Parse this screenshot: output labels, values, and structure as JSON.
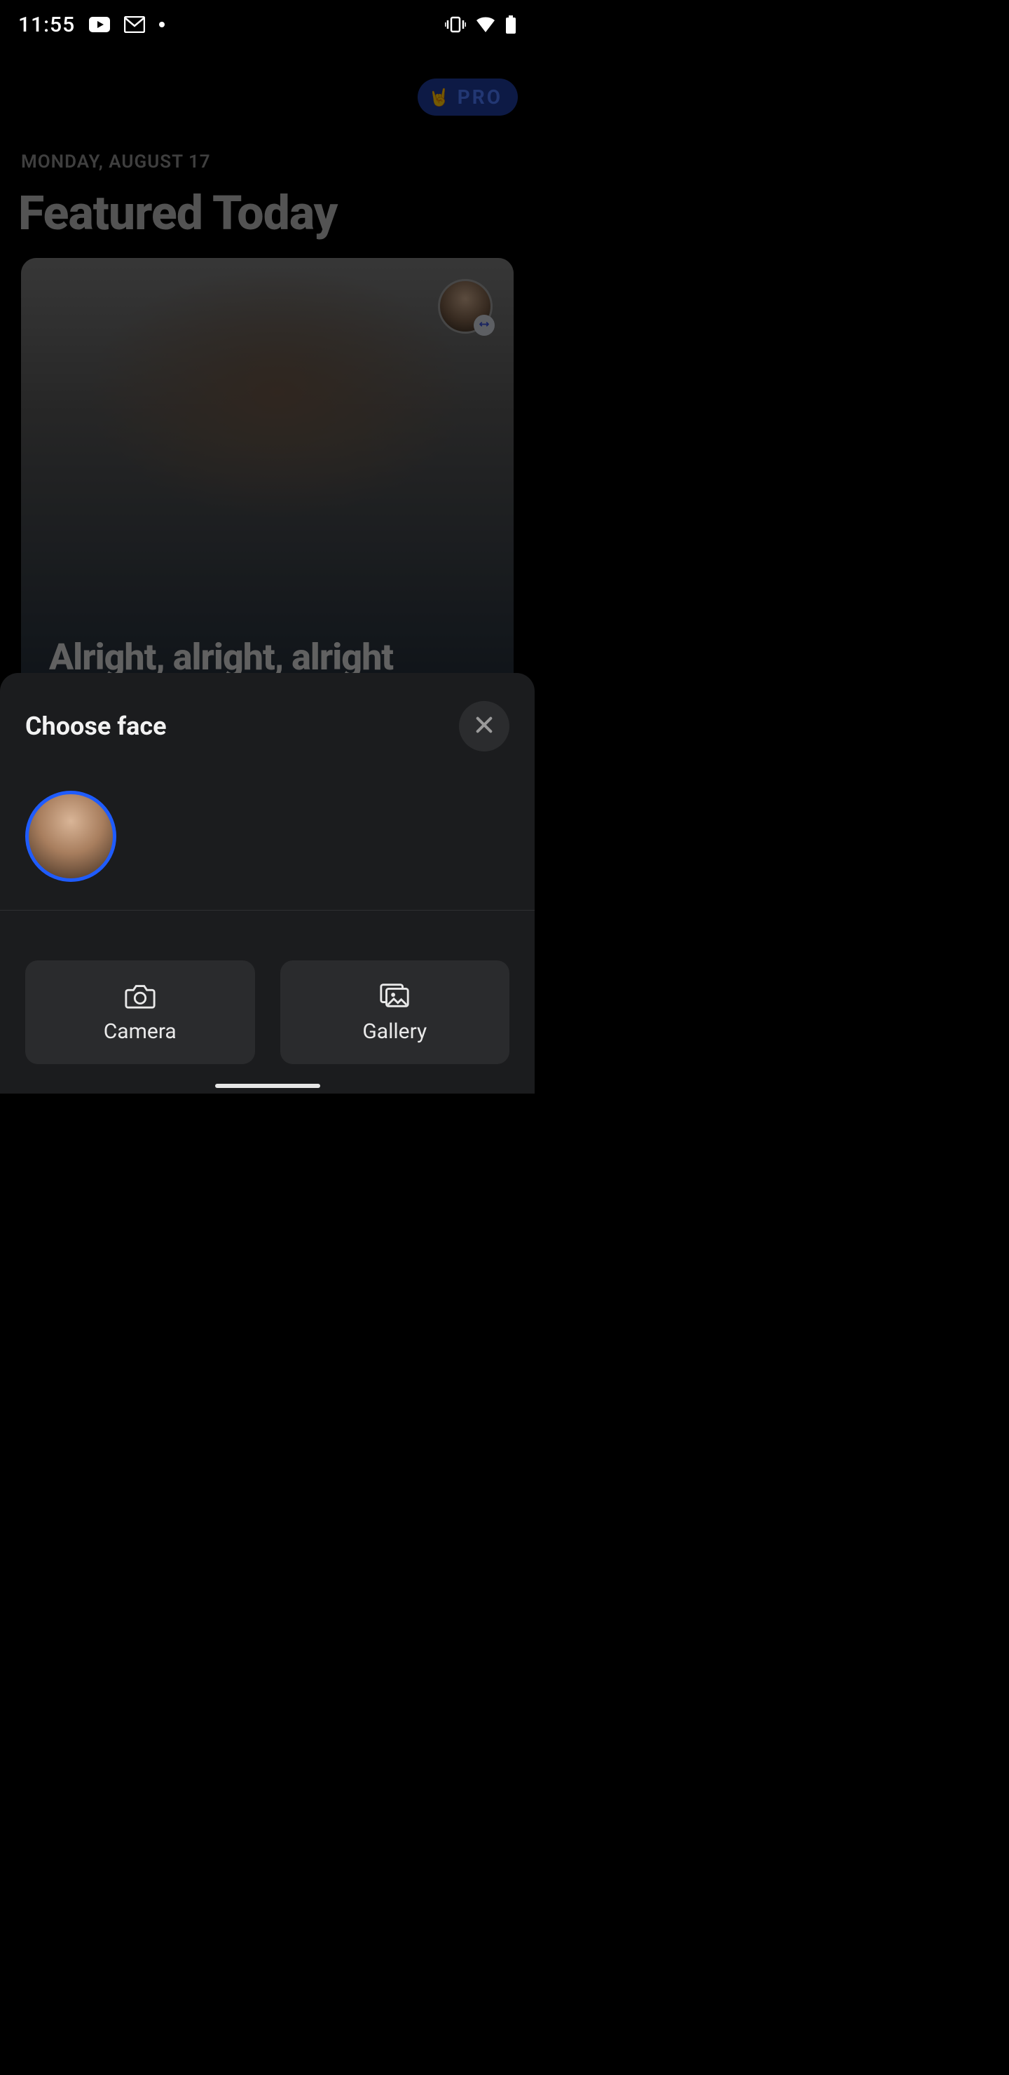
{
  "status": {
    "time": "11:55",
    "icons": [
      "youtube",
      "gmail",
      "dot",
      "vibrate",
      "wifi",
      "battery"
    ]
  },
  "pro": {
    "emoji": "🤘",
    "label": "PRO"
  },
  "date_line": "MONDAY, AUGUST 17",
  "page_title": "Featured Today",
  "feature": {
    "caption": "Alright, alright, alright",
    "swap_icon": "swap"
  },
  "sheet": {
    "title": "Choose face",
    "close": "×",
    "actions": {
      "camera_label": "Camera",
      "gallery_label": "Gallery"
    }
  },
  "accent_color": "#1f5cff"
}
